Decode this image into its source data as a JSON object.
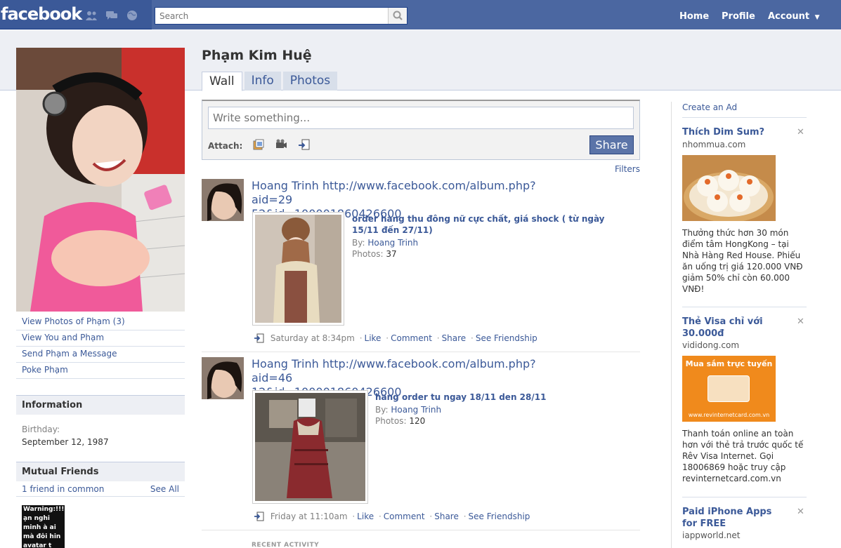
{
  "topbar": {
    "logo": "facebook",
    "search_placeholder": "Search",
    "nav": {
      "home": "Home",
      "profile": "Profile",
      "account": "Account"
    }
  },
  "profile": {
    "name": "Phạm Kim Huệ",
    "tabs": [
      "Wall",
      "Info",
      "Photos"
    ],
    "left_links": [
      "View Photos of Phạm (3)",
      "View You and Phạm",
      "Send Phạm a Message",
      "Poke Phạm"
    ],
    "information": {
      "heading": "Information",
      "birthday_label": "Birthday:",
      "birthday_value": "September 12, 1987"
    },
    "mutual_friends": {
      "heading": "Mutual Friends",
      "count_text": "1 friend in common",
      "see_all": "See All",
      "thumb_text": "Warning:!!! ạn nghi minh à ai mà đôi hin avatar t"
    }
  },
  "composer": {
    "placeholder": "Write something...",
    "attach_label": "Attach:",
    "share_label": "Share",
    "filters": "Filters"
  },
  "stories": [
    {
      "actor": "Hoang Trinh",
      "url_line1": "http://www.facebook.com/album.php?aid=29",
      "url_line2": "52&id=100001860426600",
      "album_title": "order hàng thu đông nữ cực chất, giá shock ( từ ngày 15/11 đến 27/11)",
      "by_label": "By:",
      "by_name": "Hoang Trinh",
      "photos_label": "Photos:",
      "photos_count": "37",
      "time": "Saturday at 8:34pm",
      "actions": [
        "Like",
        "Comment",
        "Share",
        "See Friendship"
      ]
    },
    {
      "actor": "Hoang Trinh",
      "url_line1": "http://www.facebook.com/album.php?aid=46",
      "url_line2": "12&id=100001860426600",
      "album_title": "hang order tu ngay 18/11 den 28/11",
      "by_label": "By:",
      "by_name": "Hoang Trinh",
      "photos_label": "Photos:",
      "photos_count": "120",
      "time": "Friday at 11:10am",
      "actions": [
        "Like",
        "Comment",
        "Share",
        "See Friendship"
      ]
    }
  ],
  "recent_activity": "RECENT ACTIVITY",
  "ads": {
    "create_ad": "Create an Ad",
    "items": [
      {
        "title": "Thích Dim Sum?",
        "domain": "nhommua.com",
        "body": "Thưởng thức hơn 30 món điểm tâm HongKong – tại Nhà Hàng Red House. Phiếu ăn uống trị giá 120.000 VNĐ giảm 50% chỉ còn 60.000 VNĐ!"
      },
      {
        "title": "Thẻ Visa chỉ với 30.000đ",
        "domain": "vididong.com",
        "img_caption": "Mua sắm trực tuyến",
        "img_footer": "www.revinternetcard.com.vn",
        "body": "Thanh toán online an toàn hơn với thẻ trả trước quốc tế Rêv Visa Internet. Gọi 18006869 hoặc truy cập revinternetcard.com.vn"
      },
      {
        "title": "Paid iPhone Apps for FREE",
        "domain": "iappworld.net"
      }
    ]
  },
  "colors": {
    "brand": "#3b5998",
    "backdrop": "#edeff4",
    "link": "#3b5998"
  }
}
